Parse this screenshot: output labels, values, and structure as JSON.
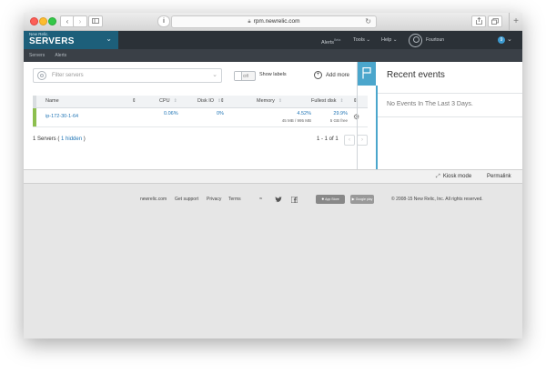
{
  "browser": {
    "url": "rpm.newrelic.com",
    "back_icon": "‹",
    "forward_icon": "›",
    "new_tab_icon": "+"
  },
  "header": {
    "brand_small": "New Relic.",
    "brand_title": "SERVERS",
    "alerts": "Alerts",
    "alerts_sup": "Beta",
    "tools": "Tools",
    "help": "Help",
    "username": "Fourtoun",
    "notification_count": "9"
  },
  "subnav": {
    "items": [
      "Servers",
      "Alerts"
    ]
  },
  "toolbar": {
    "filter_placeholder": "Filter servers",
    "toggle_state": "Off",
    "show_labels": "Show labels",
    "add_more": "Add more"
  },
  "table": {
    "columns": [
      "Name",
      "CPU",
      "Disk IO",
      "Memory",
      "Fullest disk"
    ],
    "rows": [
      {
        "name": "ip-172-30-1-64",
        "cpu": "0.06%",
        "disk_io": "0%",
        "memory": "4.52%",
        "memory_detail": "45 MB / 995 MB",
        "fullest_disk": "29.9%",
        "fullest_disk_detail": "5 GB free",
        "status_color": "#8dbf4f"
      }
    ],
    "summary_prefix": "1 Servers (",
    "summary_hidden": "1 hidden",
    "summary_suffix": ")",
    "pagination": "1 - 1 of 1"
  },
  "recent_events": {
    "title": "Recent events",
    "empty_message": "No Events In The Last 3 Days."
  },
  "bottom_bar": {
    "kiosk": "Kiosk mode",
    "permalink": "Permalink"
  },
  "footer": {
    "links": [
      "newrelic.com",
      "Get support",
      "Privacy",
      "Terms"
    ],
    "app_store": "App Store",
    "google_play": "Google play",
    "copyright": "© 2008-15 New Relic, Inc. All rights reserved."
  },
  "colors": {
    "brand": "#1d5f7a",
    "header": "#2b3137",
    "accent": "#4ba6cc",
    "link": "#1f74b5",
    "status_ok": "#8dbf4f"
  }
}
